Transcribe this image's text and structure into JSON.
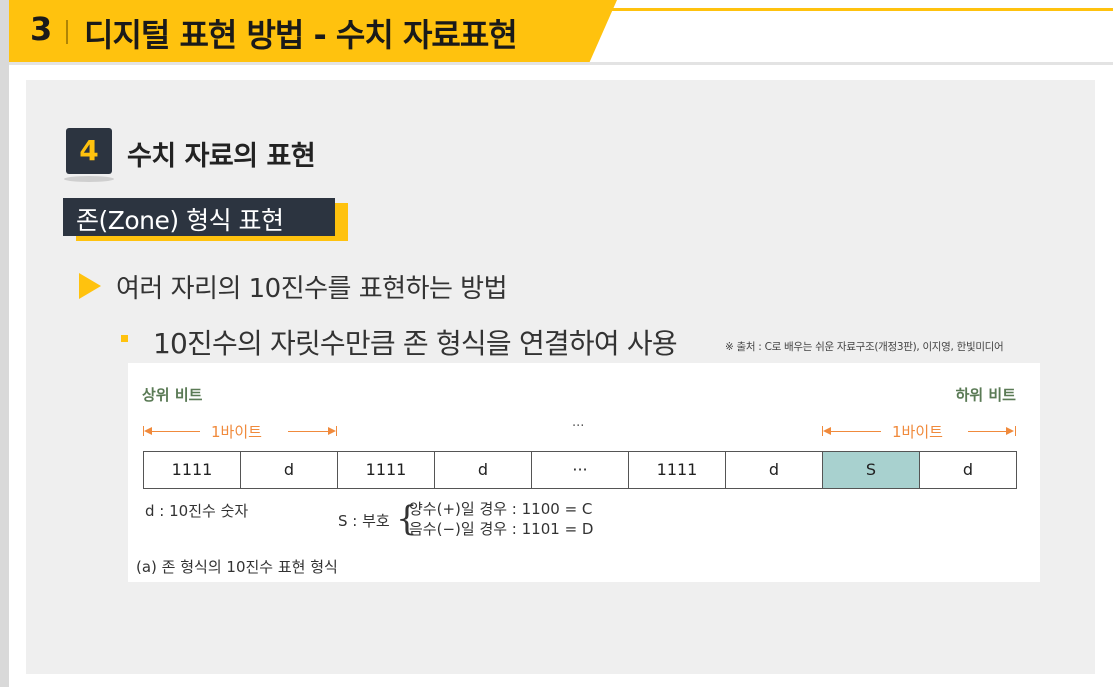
{
  "header": {
    "number": "3",
    "title": "디지털 표현 방법 - 수치 자료표현"
  },
  "section": {
    "number": "4",
    "title": "수치 자료의 표현"
  },
  "subsection": {
    "label": "존(Zone) 형식 표현"
  },
  "bullets": {
    "level1": "여러 자리의 10진수를 표현하는 방법",
    "level2": "10진수의 자릿수만큼 존 형식을 연결하여 사용"
  },
  "source": "※ 출처 : C로 배우는 쉬운 자료구조(개정3판), 이지영, 한빛미디어",
  "figure": {
    "upper_bit": "상위 비트",
    "lower_bit": "하위 비트",
    "byte_label_left": "1바이트",
    "byte_label_right": "1바이트",
    "top_dots": "···",
    "cells": [
      "1111",
      "d",
      "1111",
      "d",
      "···",
      "1111",
      "d",
      "S",
      "d"
    ],
    "highlight_index": 7,
    "legend_d": "d : 10진수  숫자",
    "legend_s": "S : 부호",
    "brace": "{",
    "sign_positive": "양수(+)일 경우 : 1100 = C",
    "sign_negative": "음수(−)일 경우 : 1101 = D",
    "caption": "(a) 존 형식의 10진수 표현 형식"
  },
  "colors": {
    "accent": "#ffc20e",
    "dark": "#2c3440",
    "highlight_cell": "#a8d1cf",
    "bracket": "#f08a3c",
    "bit_label": "#5a7a55"
  }
}
